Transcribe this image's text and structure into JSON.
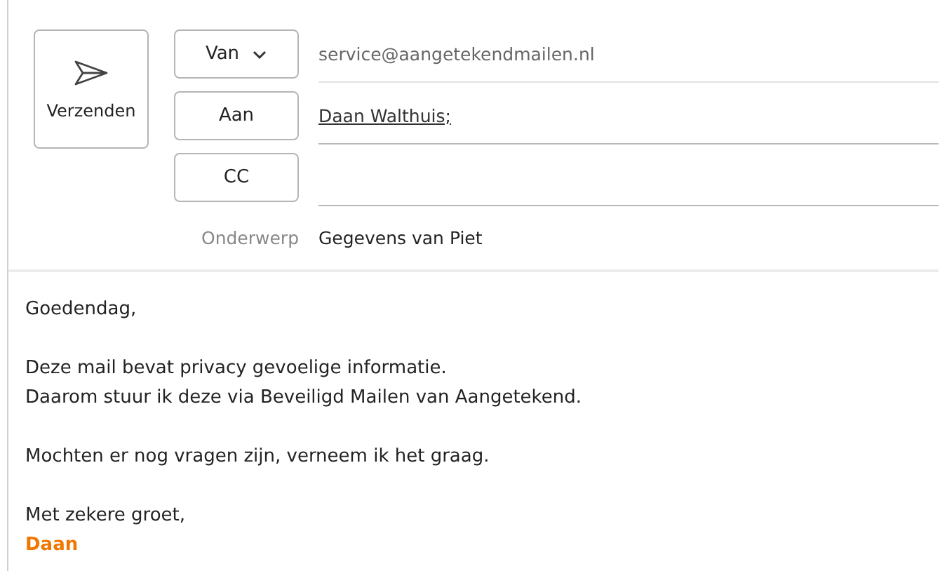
{
  "send_button": {
    "label": "Verzenden"
  },
  "header_fields": [
    {
      "kind": "from",
      "button": "Van",
      "value": "service@aangetekendmailen.nl"
    },
    {
      "kind": "recipients",
      "button": "Aan",
      "recipients": [
        "Daan Walthuis;"
      ]
    },
    {
      "kind": "recipients",
      "button": "CC"
    }
  ],
  "subject": {
    "label": "Onderwerp",
    "value": "Gegevens van Piet"
  },
  "body": {
    "paragraphs": [
      [
        "Goedendag,"
      ],
      [
        "Deze mail bevat privacy gevoelige informatie.",
        "Daarom stuur ik deze via Beveiligd Mailen van Aangetekend."
      ],
      [
        "Mochten er nog vragen zijn, verneem ik het graag."
      ],
      [
        "Met zekere groet,"
      ]
    ],
    "signature": "Daan"
  }
}
